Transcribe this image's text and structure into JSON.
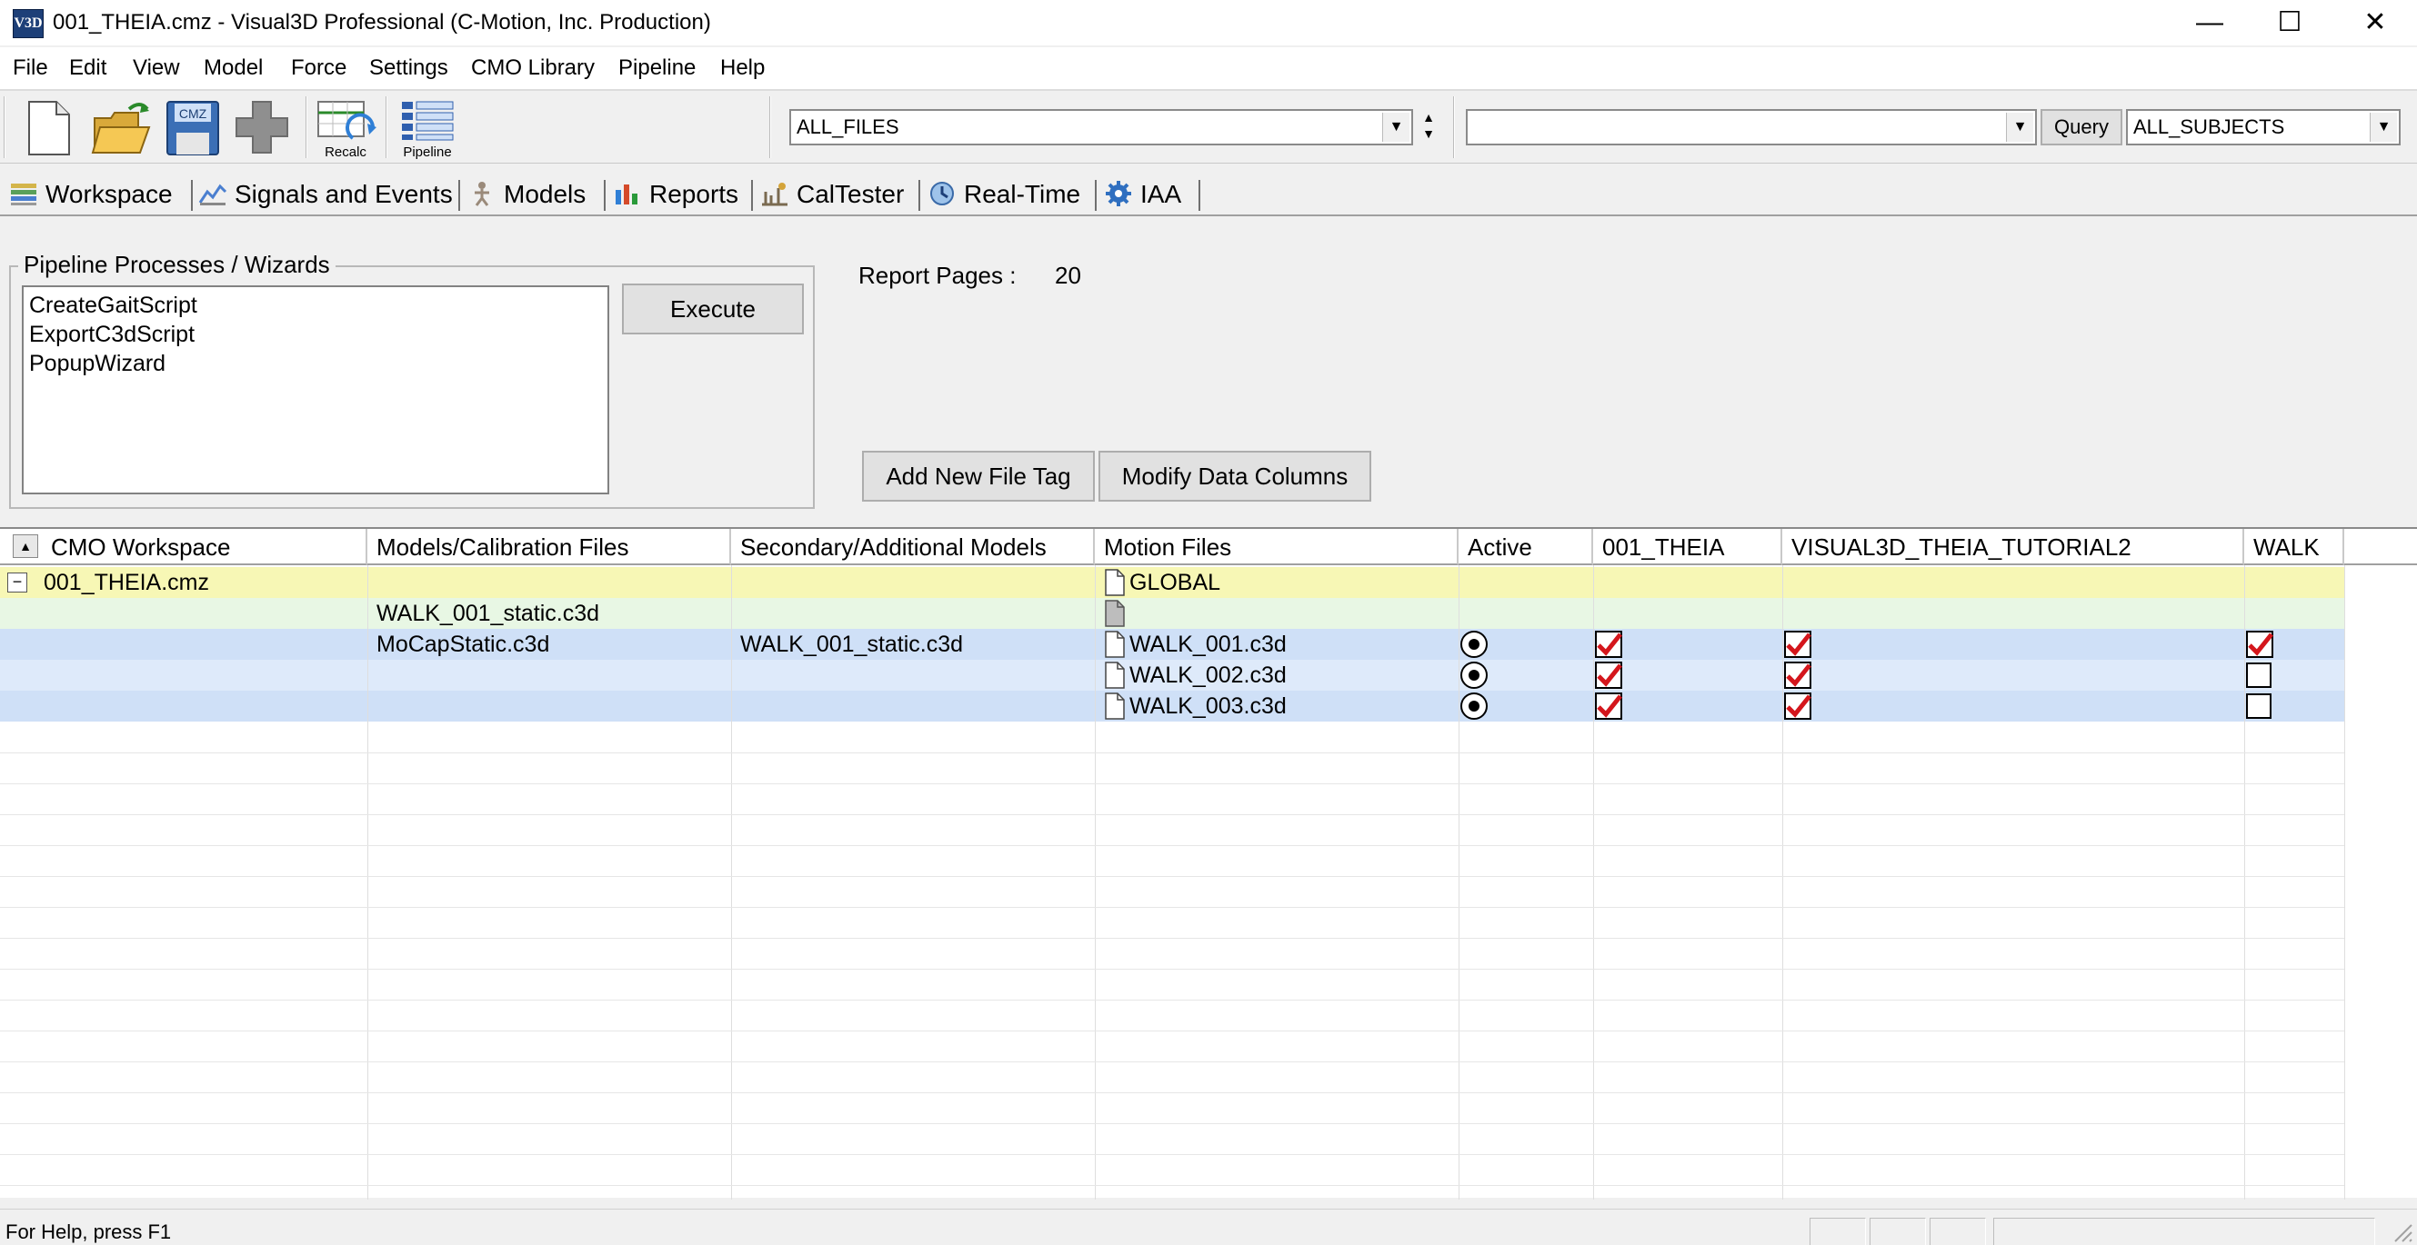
{
  "window": {
    "title": "001_THEIA.cmz - Visual3D Professional (C-Motion, Inc. Production)",
    "app_icon_text": "V3D",
    "minimize": "—",
    "maximize": "☐",
    "close": "✕"
  },
  "menu": [
    "File",
    "Edit",
    "View",
    "Model",
    "Force",
    "Settings",
    "CMO Library",
    "Pipeline",
    "Help"
  ],
  "toolbar": {
    "new_icon": "new-file-icon",
    "open_icon": "open-folder-icon",
    "save_icon": "save-cmz-icon",
    "save_badge": "CMZ",
    "add_icon": "plus-icon",
    "recalc_label": "Recalc",
    "pipeline_label": "Pipeline",
    "file_filter": "ALL_FILES",
    "tag_filter": "",
    "query_label": "Query",
    "subject_filter": "ALL_SUBJECTS"
  },
  "tabs": [
    {
      "label": "Workspace",
      "icon": "workspace-icon"
    },
    {
      "label": "Signals and Events",
      "icon": "signals-icon"
    },
    {
      "label": "Models",
      "icon": "models-icon"
    },
    {
      "label": "Reports",
      "icon": "reports-icon"
    },
    {
      "label": "CalTester",
      "icon": "caltester-icon"
    },
    {
      "label": "Real-Time",
      "icon": "realtime-icon"
    },
    {
      "label": "IAA",
      "icon": "gear-icon"
    }
  ],
  "pipeline": {
    "group_title": "Pipeline Processes / Wizards",
    "items": [
      "CreateGaitScript",
      "ExportC3dScript",
      "PopupWizard"
    ],
    "execute_label": "Execute"
  },
  "report": {
    "label": "Report Pages :",
    "value": "20"
  },
  "buttons": {
    "add_tag": "Add New File Tag",
    "modify_columns": "Modify Data Columns"
  },
  "grid": {
    "columns": [
      "CMO Workspace",
      "Models/Calibration Files",
      "Secondary/Additional Models",
      "Motion Files",
      "Active",
      "001_THEIA",
      "VISUAL3D_THEIA_TUTORIAL2",
      "WALK"
    ],
    "rows": [
      {
        "workspace": "001_THEIA.cmz",
        "model": "",
        "secondary": "",
        "motion": "GLOBAL",
        "active": null,
        "theia": null,
        "tutorial": null,
        "walk": null,
        "bg": "#f7f7b5"
      },
      {
        "workspace": "",
        "model": "WALK_001_static.c3d",
        "secondary": "",
        "motion": "",
        "active": null,
        "theia": null,
        "tutorial": null,
        "walk": null,
        "bg": "#e8f7e4"
      },
      {
        "workspace": "",
        "model": "MoCapStatic.c3d",
        "secondary": "WALK_001_static.c3d",
        "motion": "WALK_001.c3d",
        "active": true,
        "theia": true,
        "tutorial": true,
        "walk": true,
        "bg": "#cfe0f7"
      },
      {
        "workspace": "",
        "model": "",
        "secondary": "",
        "motion": "WALK_002.c3d",
        "active": true,
        "theia": true,
        "tutorial": true,
        "walk": false,
        "bg": "#deeafa"
      },
      {
        "workspace": "",
        "model": "",
        "secondary": "",
        "motion": "WALK_003.c3d",
        "active": true,
        "theia": true,
        "tutorial": true,
        "walk": false,
        "bg": "#cfe0f7"
      }
    ]
  },
  "status": {
    "text": "For Help, press F1"
  },
  "colors": {
    "checkmark": "#d4161c",
    "selection_row": "#cfe0f7",
    "global_row": "#f7f7b5",
    "static_row": "#e8f7e4"
  }
}
